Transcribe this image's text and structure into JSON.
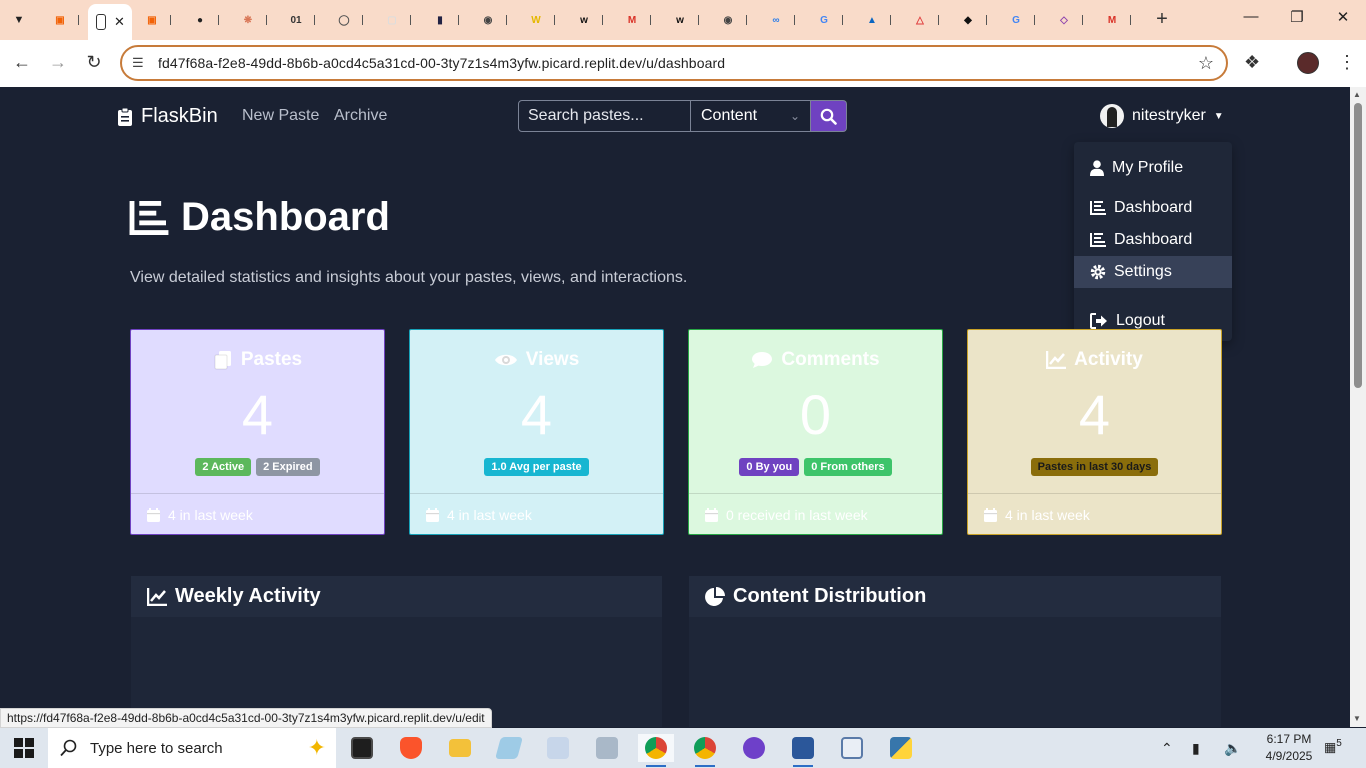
{
  "browser": {
    "tab_count_visible": 23,
    "tabs": [
      {
        "icon": "replit-icon",
        "color": "#f26207"
      },
      {
        "icon": "blank-doc-icon",
        "color": "#ffffff",
        "active": true
      },
      {
        "icon": "replit-icon",
        "color": "#f26207"
      },
      {
        "icon": "github-icon",
        "color": "#222222"
      },
      {
        "icon": "asterisk-icon",
        "color": "#d97757"
      },
      {
        "icon": "binary-icon",
        "color": "#333333"
      },
      {
        "icon": "globe-icon",
        "color": "#555555"
      },
      {
        "icon": "cube-icon",
        "color": "#dddddd"
      },
      {
        "icon": "terminal-icon",
        "color": "#222244"
      },
      {
        "icon": "chrome-icon",
        "color": "#444444"
      },
      {
        "icon": "w-logo-icon",
        "color": "#e5b800"
      },
      {
        "icon": "w-icon",
        "color": "#111111"
      },
      {
        "icon": "gmail-icon",
        "color": "#d93025"
      },
      {
        "icon": "w-icon",
        "color": "#111111"
      },
      {
        "icon": "chrome-icon",
        "color": "#444444"
      },
      {
        "icon": "link-icon",
        "color": "#2b7de9"
      },
      {
        "icon": "google-icon",
        "color": "#4285f4"
      },
      {
        "icon": "book-icon",
        "color": "#0a66c2"
      },
      {
        "icon": "triangle-icon",
        "color": "#e03a3a"
      },
      {
        "icon": "puzzle-icon",
        "color": "#111111"
      },
      {
        "icon": "google-icon",
        "color": "#4285f4"
      },
      {
        "icon": "diamond-icon",
        "color": "#8e44ad"
      },
      {
        "icon": "gmail-icon",
        "color": "#d93025"
      }
    ],
    "url": "fd47f68a-f2e8-49dd-8b6b-a0cd4c5a31cd-00-3ty7z1s4m3yfw.picard.replit.dev/u/dashboard",
    "status_url": "https://fd47f68a-f2e8-49dd-8b6b-a0cd4c5a31cd-00-3ty7z1s4m3yfw.picard.replit.dev/u/edit"
  },
  "app": {
    "brand": "FlaskBin",
    "nav": {
      "new_paste": "New Paste",
      "archive": "Archive"
    },
    "search": {
      "placeholder": "Search pastes...",
      "scope": "Content"
    },
    "user": {
      "name": "nitestryker"
    },
    "dropdown": [
      {
        "label": "My Profile",
        "icon": "user-icon"
      },
      {
        "label": "Dashboard",
        "icon": "chart-bar-icon"
      },
      {
        "label": "Dashboard",
        "icon": "chart-bar-icon"
      },
      {
        "label": "Settings",
        "icon": "gear-icon",
        "active": true
      },
      {
        "label": "Logout",
        "icon": "logout-icon"
      }
    ]
  },
  "dashboard": {
    "title": "Dashboard",
    "subtitle": "View detailed statistics and insights about your pastes, views, and interactions.",
    "cards": [
      {
        "title": "Pastes",
        "icon": "copy-icon",
        "value": "4",
        "bg": "#e0dcff",
        "border": "#6f42c1",
        "badges": [
          {
            "label": "2 Active",
            "color": "#5cb85c"
          },
          {
            "label": "2 Expired",
            "color": "#8e96a3"
          }
        ],
        "footer": "4 in last week"
      },
      {
        "title": "Views",
        "icon": "eye-icon",
        "value": "4",
        "bg": "#d3f1f6",
        "border": "#17a2b8",
        "badges": [
          {
            "label": "1.0 Avg per paste",
            "color": "#17b6d1"
          }
        ],
        "footer": "4 in last week"
      },
      {
        "title": "Comments",
        "icon": "comment-icon",
        "value": "0",
        "bg": "#dcf8df",
        "border": "#28a745",
        "badges": [
          {
            "label": "0 By you",
            "color": "#6f42c1"
          },
          {
            "label": "0 From others",
            "color": "#3dc46a"
          }
        ],
        "footer": "0 received in last week"
      },
      {
        "title": "Activity",
        "icon": "line-chart-icon",
        "value": "4",
        "bg": "#ebe4c8",
        "border": "#c9a227",
        "badges": [
          {
            "label": "Pastes in last 30 days",
            "color": "#8a6d0b",
            "text": "#1a1a1a"
          }
        ],
        "footer": "4 in last week"
      }
    ],
    "panels": {
      "weekly": "Weekly Activity",
      "distribution": "Content Distribution"
    }
  },
  "taskbar": {
    "search_placeholder": "Type here to search",
    "time": "6:17 PM",
    "date": "4/9/2025",
    "notifications": "5"
  }
}
